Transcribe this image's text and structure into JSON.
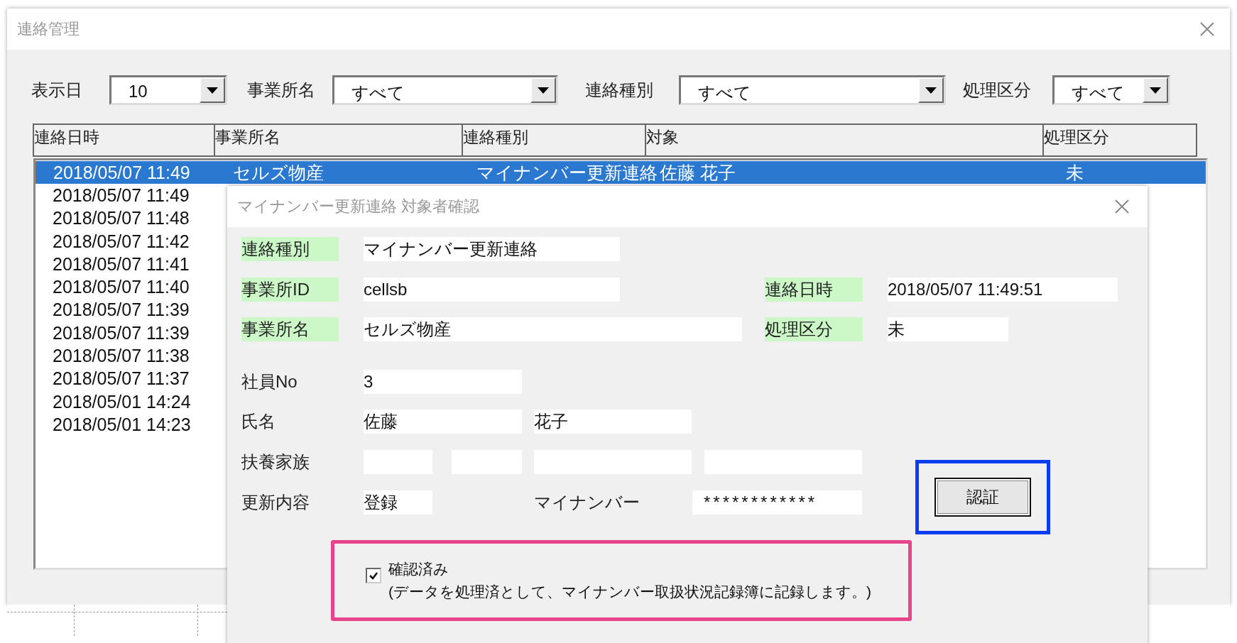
{
  "window": {
    "title": "連絡管理"
  },
  "filters": [
    {
      "label": "表示日",
      "value": "10"
    },
    {
      "label": "事業所名",
      "value": "すべて"
    },
    {
      "label": "連絡種別",
      "value": "すべて"
    },
    {
      "label": "処理区分",
      "value": "すべて"
    }
  ],
  "table": {
    "columns": [
      "連絡日時",
      "事業所名",
      "連絡種別",
      "対象",
      "処理区分"
    ],
    "rows": [
      {
        "selected": true,
        "cells": [
          "2018/05/07 11:49",
          "セルズ物産",
          "マイナンバー更新連絡",
          "佐藤 花子",
          "未"
        ]
      },
      {
        "selected": false,
        "cells": [
          "2018/05/07 11:49"
        ]
      },
      {
        "selected": false,
        "cells": [
          "2018/05/07 11:48"
        ]
      },
      {
        "selected": false,
        "cells": [
          "2018/05/07 11:42"
        ]
      },
      {
        "selected": false,
        "cells": [
          "2018/05/07 11:41"
        ]
      },
      {
        "selected": false,
        "cells": [
          "2018/05/07 11:40"
        ]
      },
      {
        "selected": false,
        "cells": [
          "2018/05/07 11:39"
        ]
      },
      {
        "selected": false,
        "cells": [
          "2018/05/07 11:39"
        ]
      },
      {
        "selected": false,
        "cells": [
          "2018/05/07 11:38"
        ]
      },
      {
        "selected": false,
        "cells": [
          "2018/05/07 11:37"
        ]
      },
      {
        "selected": false,
        "cells": [
          "2018/05/01 14:24"
        ]
      },
      {
        "selected": false,
        "cells": [
          "2018/05/01 14:23"
        ]
      }
    ]
  },
  "dialog": {
    "title": "マイナンバー更新連絡 対象者確認",
    "form_rows": [
      [
        {
          "kind": "label",
          "text": "連絡種別",
          "highlighted": true
        },
        {
          "kind": "field",
          "value": "マイナンバー更新連絡"
        }
      ],
      [
        {
          "kind": "label",
          "text": "事業所ID",
          "highlighted": true
        },
        {
          "kind": "field",
          "value": "cellsb"
        },
        {
          "kind": "label",
          "text": "連絡日時",
          "highlighted": true
        },
        {
          "kind": "field",
          "value": "2018/05/07 11:49:51"
        }
      ],
      [
        {
          "kind": "label",
          "text": "事業所名",
          "highlighted": true
        },
        {
          "kind": "field",
          "value": "セルズ物産"
        },
        {
          "kind": "label",
          "text": "処理区分",
          "highlighted": true
        },
        {
          "kind": "field",
          "value": "未"
        }
      ],
      [
        {
          "kind": "label",
          "text": "社員No",
          "highlighted": false
        },
        {
          "kind": "field",
          "value": "3"
        }
      ],
      [
        {
          "kind": "label",
          "text": "氏名",
          "highlighted": false
        },
        {
          "kind": "field",
          "value": "佐藤"
        },
        {
          "kind": "field",
          "value": "花子"
        }
      ],
      [
        {
          "kind": "label",
          "text": "扶養家族",
          "highlighted": false
        },
        {
          "kind": "field"
        },
        {
          "kind": "field"
        },
        {
          "kind": "field"
        },
        {
          "kind": "field"
        }
      ],
      [
        {
          "kind": "label",
          "text": "更新内容",
          "highlighted": false
        },
        {
          "kind": "field",
          "value": "登録"
        },
        {
          "kind": "label",
          "text": "マイナンバー",
          "highlighted": false
        },
        {
          "kind": "field",
          "value": "************"
        }
      ]
    ],
    "auth_button": "認証",
    "confirm": {
      "checked": true,
      "label": "確認済み",
      "note": "(データを処理済として、マイナンバー取扱状況記録簿に記録します。)"
    }
  }
}
